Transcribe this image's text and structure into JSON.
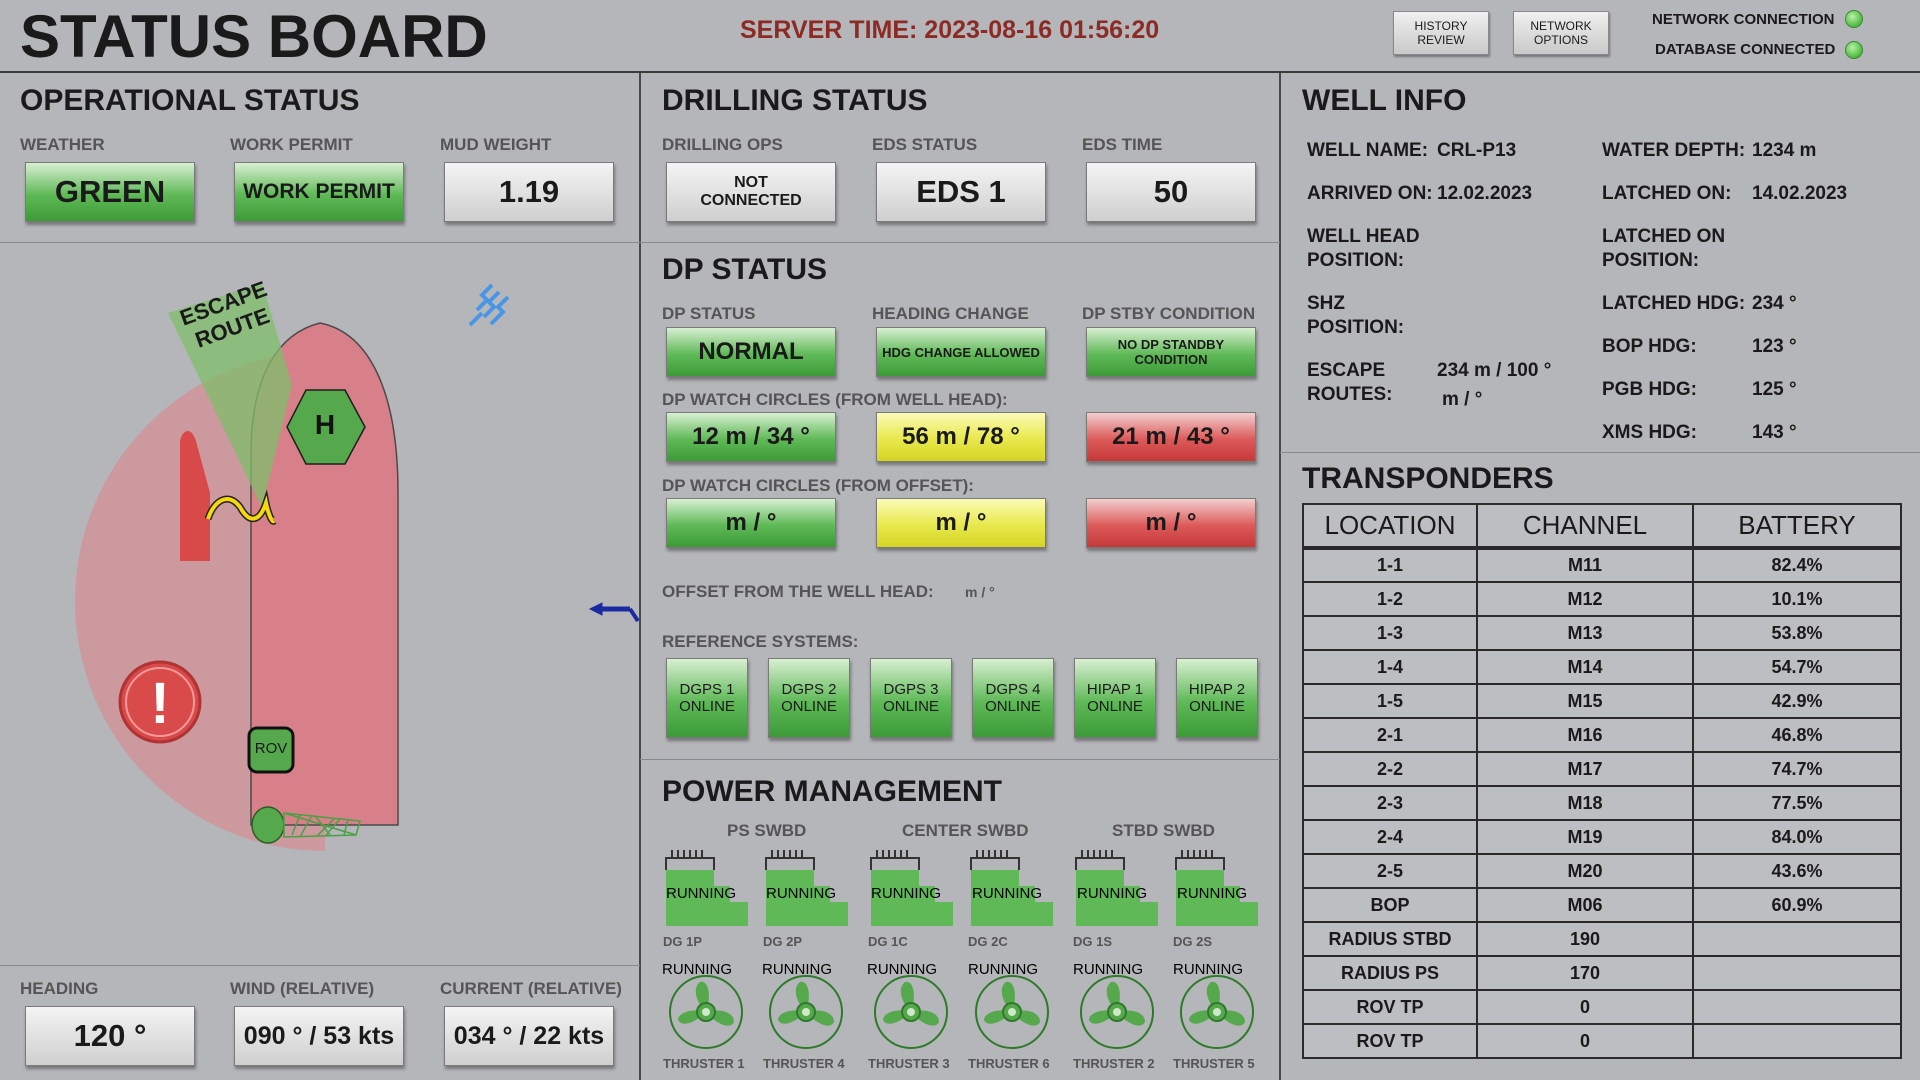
{
  "header": {
    "title": "STATUS BOARD",
    "server_time": "SERVER TIME: 2023-08-16 01:56:20",
    "history_button": "HISTORY REVIEW",
    "network_button": "NETWORK OPTIONS",
    "network_connection": "NETWORK CONNECTION",
    "database_connection": "DATABASE CONNECTED",
    "status_color": "#4cbb3e"
  },
  "operational": {
    "title": "OPERATIONAL STATUS",
    "weather_label": "WEATHER",
    "weather_value": "GREEN",
    "permit_label": "WORK PERMIT",
    "permit_value": "WORK PERMIT",
    "mud_label": "MUD WEIGHT",
    "mud_value": "1.19"
  },
  "vessel": {
    "escape_route": "ESCAPE ROUTE",
    "helipad": "H",
    "rov": "ROV",
    "alert": "!"
  },
  "bottom": {
    "heading_label": "HEADING",
    "heading_value": "120 °",
    "wind_label": "WIND (RELATIVE)",
    "wind_value": "090 ° / 53 kts",
    "current_label": "CURRENT (RELATIVE)",
    "current_value": "034 ° / 22 kts"
  },
  "drilling": {
    "title": "DRILLING STATUS",
    "ops_label": "DRILLING OPS",
    "ops_value": "NOT CONNECTED",
    "eds_label": "EDS STATUS",
    "eds_value": "EDS 1",
    "eds_time_label": "EDS TIME",
    "eds_time_value": "50"
  },
  "dp": {
    "title": "DP STATUS",
    "status_label": "DP STATUS",
    "status_value": "NORMAL",
    "heading_label": "HEADING CHANGE",
    "heading_value": "HDG CHANGE ALLOWED",
    "stby_label": "DP STBY CONDITION",
    "stby_value": "NO DP STANDBY CONDITION",
    "watch_head_label": "DP WATCH CIRCLES (FROM WELL HEAD):",
    "watch_head": [
      "12 m / 34 °",
      "56 m / 78 °",
      "21 m / 43 °"
    ],
    "watch_offset_label": "DP WATCH CIRCLES (FROM OFFSET):",
    "watch_offset": [
      "m / °",
      "m / °",
      "m / °"
    ],
    "offset_label": "OFFSET FROM THE WELL HEAD:",
    "offset_value": "m / °",
    "ref_label": "REFERENCE SYSTEMS:",
    "ref_systems": [
      "DGPS 1 ONLINE",
      "DGPS 2 ONLINE",
      "DGPS 3 ONLINE",
      "DGPS 4 ONLINE",
      "HIPAP 1 ONLINE",
      "HIPAP 2 ONLINE"
    ]
  },
  "power": {
    "title": "POWER MANAGEMENT",
    "swbd": [
      "PS SWBD",
      "CENTER SWBD",
      "STBD SWBD"
    ],
    "generators": [
      {
        "status": "RUNNING",
        "name": "DG 1P"
      },
      {
        "status": "RUNNING",
        "name": "DG 2P"
      },
      {
        "status": "RUNNING",
        "name": "DG 1C"
      },
      {
        "status": "RUNNING",
        "name": "DG 2C"
      },
      {
        "status": "RUNNING",
        "name": "DG 1S"
      },
      {
        "status": "RUNNING",
        "name": "DG 2S"
      }
    ],
    "thrusters": [
      {
        "status": "RUNNING",
        "name": "THRUSTER 1"
      },
      {
        "status": "RUNNING",
        "name": "THRUSTER 4"
      },
      {
        "status": "RUNNING",
        "name": "THRUSTER 3"
      },
      {
        "status": "RUNNING",
        "name": "THRUSTER 6"
      },
      {
        "status": "RUNNING",
        "name": "THRUSTER 2"
      },
      {
        "status": "RUNNING",
        "name": "THRUSTER 5"
      }
    ]
  },
  "well": {
    "title": "WELL INFO",
    "well_name_label": "WELL NAME:",
    "well_name": "CRL-P13",
    "water_depth_label": "WATER DEPTH:",
    "water_depth": "1234 m",
    "arrived_label": "ARRIVED ON:",
    "arrived": "12.02.2023",
    "latched_label": "LATCHED ON:",
    "latched": "14.02.2023",
    "wellhead_label_1": "WELL HEAD",
    "wellhead_label_2": "POSITION:",
    "latched_pos_label_1": "LATCHED ON",
    "latched_pos_label_2": "POSITION:",
    "shz_label_1": "SHZ",
    "shz_label_2": "POSITION:",
    "latched_hdg_label": "LATCHED HDG:",
    "latched_hdg": "234 °",
    "bop_hdg_label": "BOP HDG:",
    "bop_hdg": "123 °",
    "escape_label_1": "ESCAPE",
    "escape_label_2": "ROUTES:",
    "escape_1": "234 m / 100 °",
    "escape_2": "m /  °",
    "pgb_hdg_label": "PGB HDG:",
    "pgb_hdg": "125 °",
    "xms_hdg_label": "XMS HDG:",
    "xms_hdg": "143 °"
  },
  "transponders": {
    "title": "TRANSPONDERS",
    "headers": [
      "LOCATION",
      "CHANNEL",
      "BATTERY"
    ],
    "rows": [
      [
        "1-1",
        "M11",
        "82.4%"
      ],
      [
        "1-2",
        "M12",
        "10.1%"
      ],
      [
        "1-3",
        "M13",
        "53.8%"
      ],
      [
        "1-4",
        "M14",
        "54.7%"
      ],
      [
        "1-5",
        "M15",
        "42.9%"
      ],
      [
        "2-1",
        "M16",
        "46.8%"
      ],
      [
        "2-2",
        "M17",
        "74.7%"
      ],
      [
        "2-3",
        "M18",
        "77.5%"
      ],
      [
        "2-4",
        "M19",
        "84.0%"
      ],
      [
        "2-5",
        "M20",
        "43.6%"
      ],
      [
        "BOP",
        "M06",
        "60.9%"
      ],
      [
        "RADIUS STBD",
        "190",
        ""
      ],
      [
        "RADIUS PS",
        "170",
        ""
      ],
      [
        "ROV TP",
        "0",
        ""
      ],
      [
        "ROV TP",
        "0",
        ""
      ]
    ]
  }
}
